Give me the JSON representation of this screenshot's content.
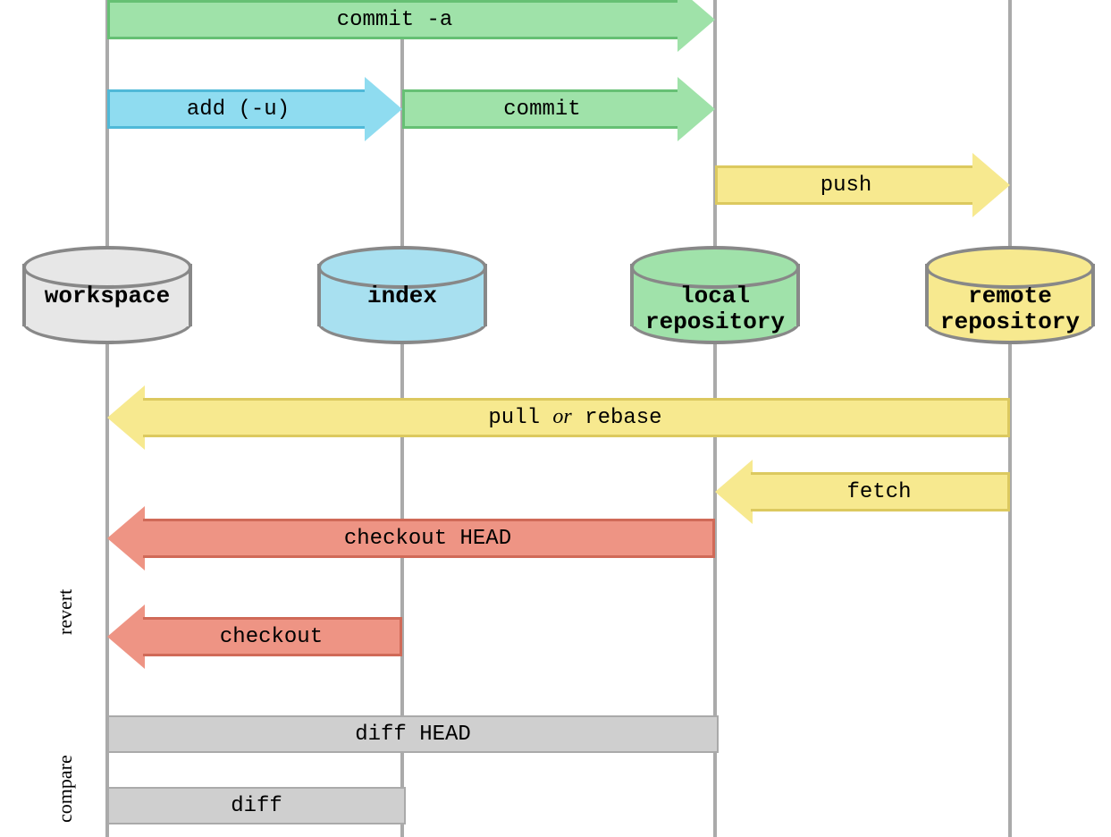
{
  "nodes": {
    "workspace": "workspace",
    "index": "index",
    "local": "local repository",
    "remote": "remote repository"
  },
  "arrows": {
    "commit_a": "commit -a",
    "add": "add (-u)",
    "commit": "commit",
    "push": "push",
    "pull_prefix": "pull",
    "pull_or": "or",
    "pull_suffix": "rebase",
    "fetch": "fetch",
    "checkout_head": "checkout HEAD",
    "checkout": "checkout"
  },
  "bars": {
    "diff_head": "diff HEAD",
    "diff": "diff"
  },
  "sections": {
    "revert": "revert",
    "compare": "compare"
  },
  "colors": {
    "green_fill": "#9fe2a9",
    "green_stroke": "#66c074",
    "blue_fill": "#8fdcf0",
    "blue_stroke": "#4fb9d8",
    "yellow_fill": "#f7e98f",
    "yellow_stroke": "#dcc95f",
    "red_fill": "#ee9484",
    "red_stroke": "#d06a58",
    "grey_fill": "#e7e7e7",
    "grey_stroke": "#9c9c9c",
    "cyl_workspace": "#e7e7e7",
    "cyl_index": "#a8e0f0",
    "cyl_local": "#a0e2aa",
    "cyl_remote": "#f7e98f"
  },
  "layout": {
    "cols": {
      "workspace": 120,
      "index": 450,
      "local": 800,
      "remote": 1130
    }
  }
}
